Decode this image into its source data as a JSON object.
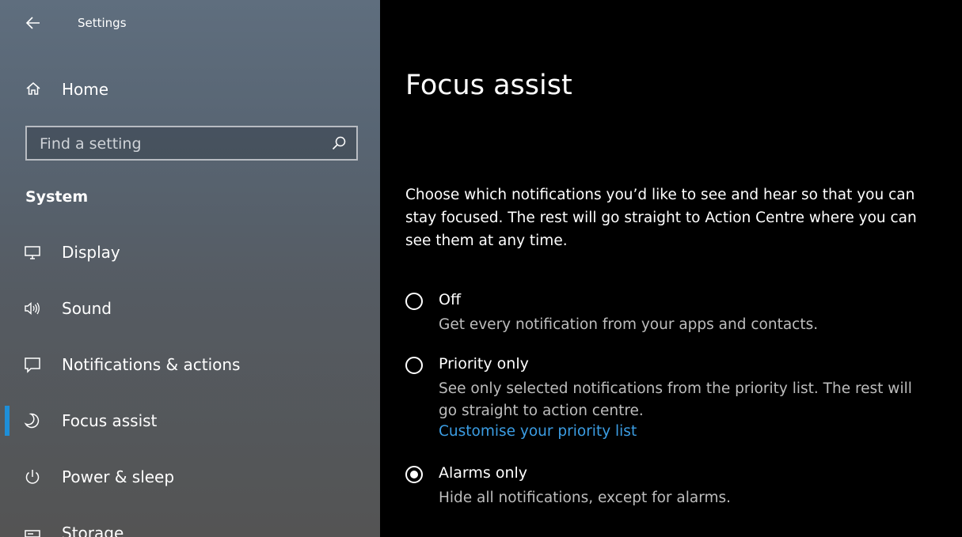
{
  "window": {
    "title": "Settings",
    "back_icon": "arrow-left-icon"
  },
  "sidebar": {
    "home": {
      "label": "Home",
      "icon": "home-icon"
    },
    "search": {
      "placeholder": "Find a setting",
      "value": "",
      "icon": "search-icon"
    },
    "section": "System",
    "items": [
      {
        "label": "Display",
        "icon": "monitor-icon",
        "active": false
      },
      {
        "label": "Sound",
        "icon": "speaker-icon",
        "active": false
      },
      {
        "label": "Notifications & actions",
        "icon": "message-icon",
        "active": false
      },
      {
        "label": "Focus assist",
        "icon": "moon-icon",
        "active": true
      },
      {
        "label": "Power & sleep",
        "icon": "power-icon",
        "active": false
      },
      {
        "label": "Storage",
        "icon": "storage-icon",
        "active": false
      }
    ]
  },
  "main": {
    "title": "Focus assist",
    "intro": "Choose which notifications you’d like to see and hear so that you can stay focused. The rest will go straight to Action Centre where you can see them at any time.",
    "options": [
      {
        "label": "Off",
        "description": "Get every notification from your apps and contacts.",
        "checked": false
      },
      {
        "label": "Priority only",
        "description": "See only selected notifications from the priority list. The rest will go straight to action centre.",
        "link": "Customise your priority list",
        "checked": false
      },
      {
        "label": "Alarms only",
        "description": "Hide all notifications, except for alarms.",
        "checked": true
      }
    ]
  },
  "colors": {
    "accent": "#1e8fd8",
    "link": "#3b9de3",
    "secondary_text": "#bdbdbd",
    "main_background": "#000000"
  }
}
